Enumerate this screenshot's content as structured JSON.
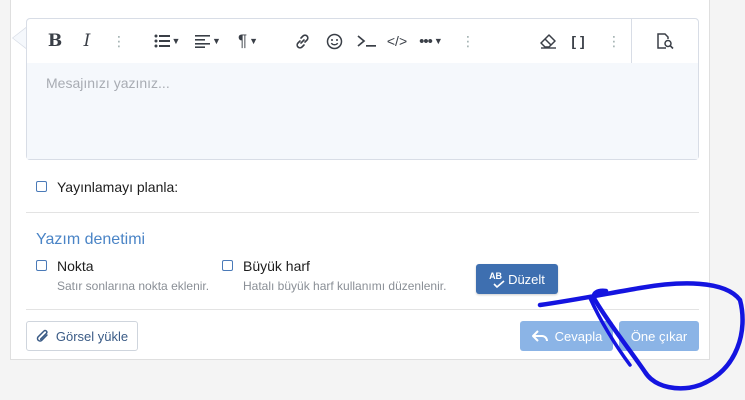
{
  "editor": {
    "placeholder": "Mesajınızı yazınız...",
    "toolbar": {
      "bold": "B",
      "italic": "I",
      "more": "⋮",
      "paragraph": "¶",
      "code_inline": "</>",
      "brackets": "[ ]"
    }
  },
  "schedule": {
    "label": "Yayınlamayı planla:"
  },
  "spellcheck": {
    "title": "Yazım denetimi",
    "options": [
      {
        "label": "Nokta",
        "hint": "Satır sonlarına nokta eklenir."
      },
      {
        "label": "Büyük harf",
        "hint": "Hatalı büyük harf kullanımı düzenlenir."
      }
    ],
    "fix_button": {
      "badge": "AB",
      "label": "Düzelt"
    }
  },
  "footer": {
    "upload_label": "Görsel yükle",
    "reply_label": "Cevapla",
    "promote_label": "Öne çıkar"
  },
  "colors": {
    "accent": "#3e6fb0",
    "link": "#4a84c6",
    "scribble": "#1414e0"
  }
}
